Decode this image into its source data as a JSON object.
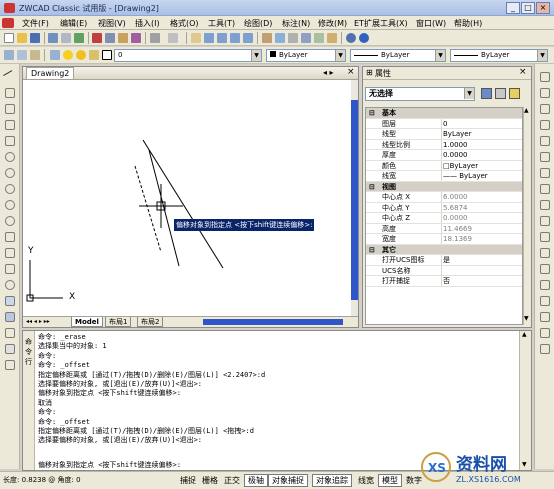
{
  "window": {
    "title": "ZWCAD Classic 试用版 - [Drawing2]",
    "min": "_",
    "max": "□",
    "close": "×"
  },
  "menu": [
    "文件(F)",
    "编辑(E)",
    "视图(V)",
    "插入(I)",
    "格式(O)",
    "工具(T)",
    "绘图(D)",
    "标注(N)",
    "修改(M)",
    "ET扩展工具(X)",
    "窗口(W)",
    "帮助(H)"
  ],
  "toolbar3": {
    "layer_value": "0",
    "color_value": "ByLayer",
    "linetype_value": "ByLayer",
    "lineweight_value": "ByLayer"
  },
  "document": {
    "tab": "Drawing2",
    "axis_y": "Y",
    "axis_x": "X",
    "tooltip": "偏移对象到指定点 <按下shift键连续偏移>:",
    "layouts": [
      "Model",
      "布局1",
      "布局2"
    ]
  },
  "properties": {
    "title": "属性",
    "selection": "无选择",
    "groups": [
      {
        "name": "基本",
        "rows": [
          {
            "name": "图层",
            "value": "0"
          },
          {
            "name": "线型",
            "value": "ByLayer"
          },
          {
            "name": "线型比例",
            "value": "1.0000"
          },
          {
            "name": "厚度",
            "value": "0.0000"
          },
          {
            "name": "颜色",
            "value": "□ByLayer"
          },
          {
            "name": "线宽",
            "value": "—— ByLayer"
          }
        ]
      },
      {
        "name": "视图",
        "rows": [
          {
            "name": "中心点 X",
            "value": "6.0000",
            "gray": true
          },
          {
            "name": "中心点 Y",
            "value": "5.6874",
            "gray": true
          },
          {
            "name": "中心点 Z",
            "value": "0.0000",
            "gray": true
          },
          {
            "name": "高度",
            "value": "11.4669",
            "gray": true
          },
          {
            "name": "宽度",
            "value": "18.1369",
            "gray": true
          }
        ]
      },
      {
        "name": "其它",
        "rows": [
          {
            "name": "打开UCS图标",
            "value": "是"
          },
          {
            "name": "UCS名称",
            "value": ""
          },
          {
            "name": "打开捕捉",
            "value": "否"
          }
        ]
      }
    ]
  },
  "command": {
    "side_label": "命令行",
    "lines": [
      "命令: _erase",
      "选择集当中的对象: 1",
      "命令:",
      "命令: _offset",
      "指定偏移距离或 [通过(T)/拖拽(D)/删除(E)/图层(L)] <2.2407>:d",
      "选择要偏移的对象, 或[退出(E)/放弃(U)]<退出>:",
      "偏移对象到指定点 <按下shift键连续偏移>:",
      "取消",
      "命令:",
      "命令: _offset",
      "指定偏移距离或 [通过(T)/拖拽(D)/删除(E)/图层(L)] <拖拽>:d",
      "选择要偏移的对象, 或[退出(E)/放弃(U)]<退出>:"
    ],
    "current": "偏移对象到指定点 <按下shift键连续偏移>:"
  },
  "status": {
    "coords": "长度: 0.8238 @ 角度: 0",
    "buttons": [
      "捕捉",
      "栅格",
      "正交",
      "极轴",
      "对象捕捉",
      "对象追踪",
      "线宽",
      "模型",
      "数字"
    ]
  },
  "watermark": {
    "text": "资料网",
    "url": "ZL.XS1616.COM"
  }
}
